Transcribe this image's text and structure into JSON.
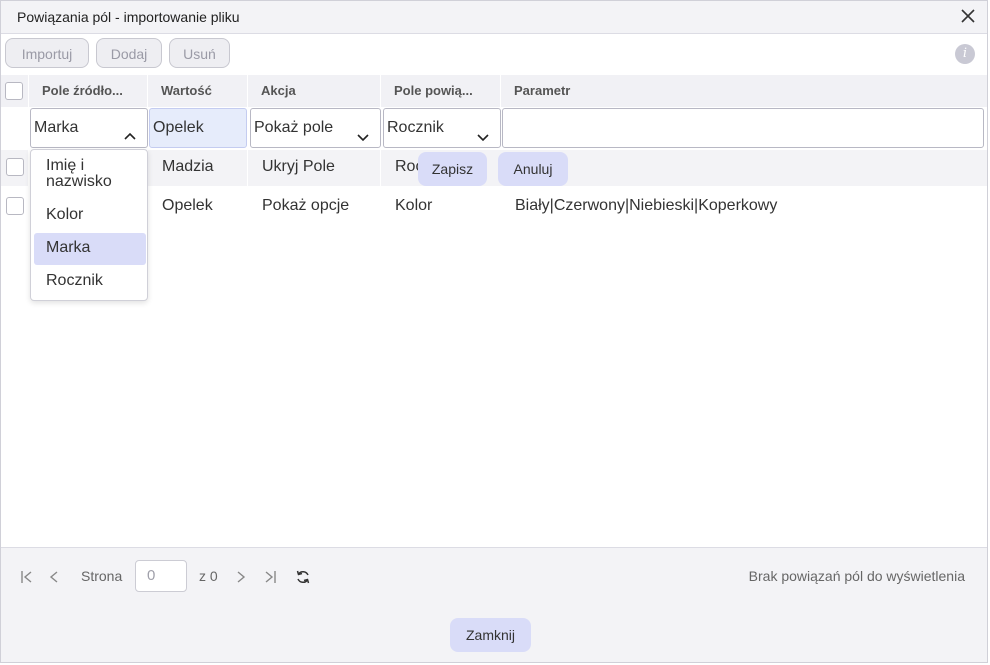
{
  "dialog": {
    "title": "Powiązania pól - importowanie pliku"
  },
  "toolbar": {
    "import_label": "Importuj",
    "add_label": "Dodaj",
    "remove_label": "Usuń",
    "info_label": "i"
  },
  "columns": {
    "source_field": "Pole źródło...",
    "value": "Wartość",
    "action": "Akcja",
    "linked_field": "Pole powią...",
    "parameter": "Parametr"
  },
  "edit_row": {
    "source_field": "Marka",
    "value": "Opelek",
    "action": "Pokaż pole",
    "linked_field": "Rocznik",
    "parameter": ""
  },
  "rows": [
    {
      "value": "Madzia",
      "action": "Ukryj Pole",
      "linked_field": "Roc",
      "save_label": "Zapisz",
      "cancel_label": "Anuluj"
    },
    {
      "value": "Opelek",
      "action": "Pokaż opcje",
      "linked_field": "Kolor",
      "parameter": "Biały|Czerwony|Niebieski|Koperkowy"
    }
  ],
  "dropdown": {
    "options": [
      "Imię i",
      "nazwisko",
      "Kolor",
      "Marka",
      "Rocznik"
    ],
    "selected": "Marka"
  },
  "pager": {
    "page_label": "Strona",
    "page_value": "0",
    "of_label": "z 0",
    "status": "Brak powiązań pól do wyświetlenia"
  },
  "footer": {
    "close_label": "Zamknij"
  },
  "colors": {
    "accent": "#d9dcf8",
    "value_bg": "#e6ecfb",
    "header_bg": "#f1f1f5"
  }
}
